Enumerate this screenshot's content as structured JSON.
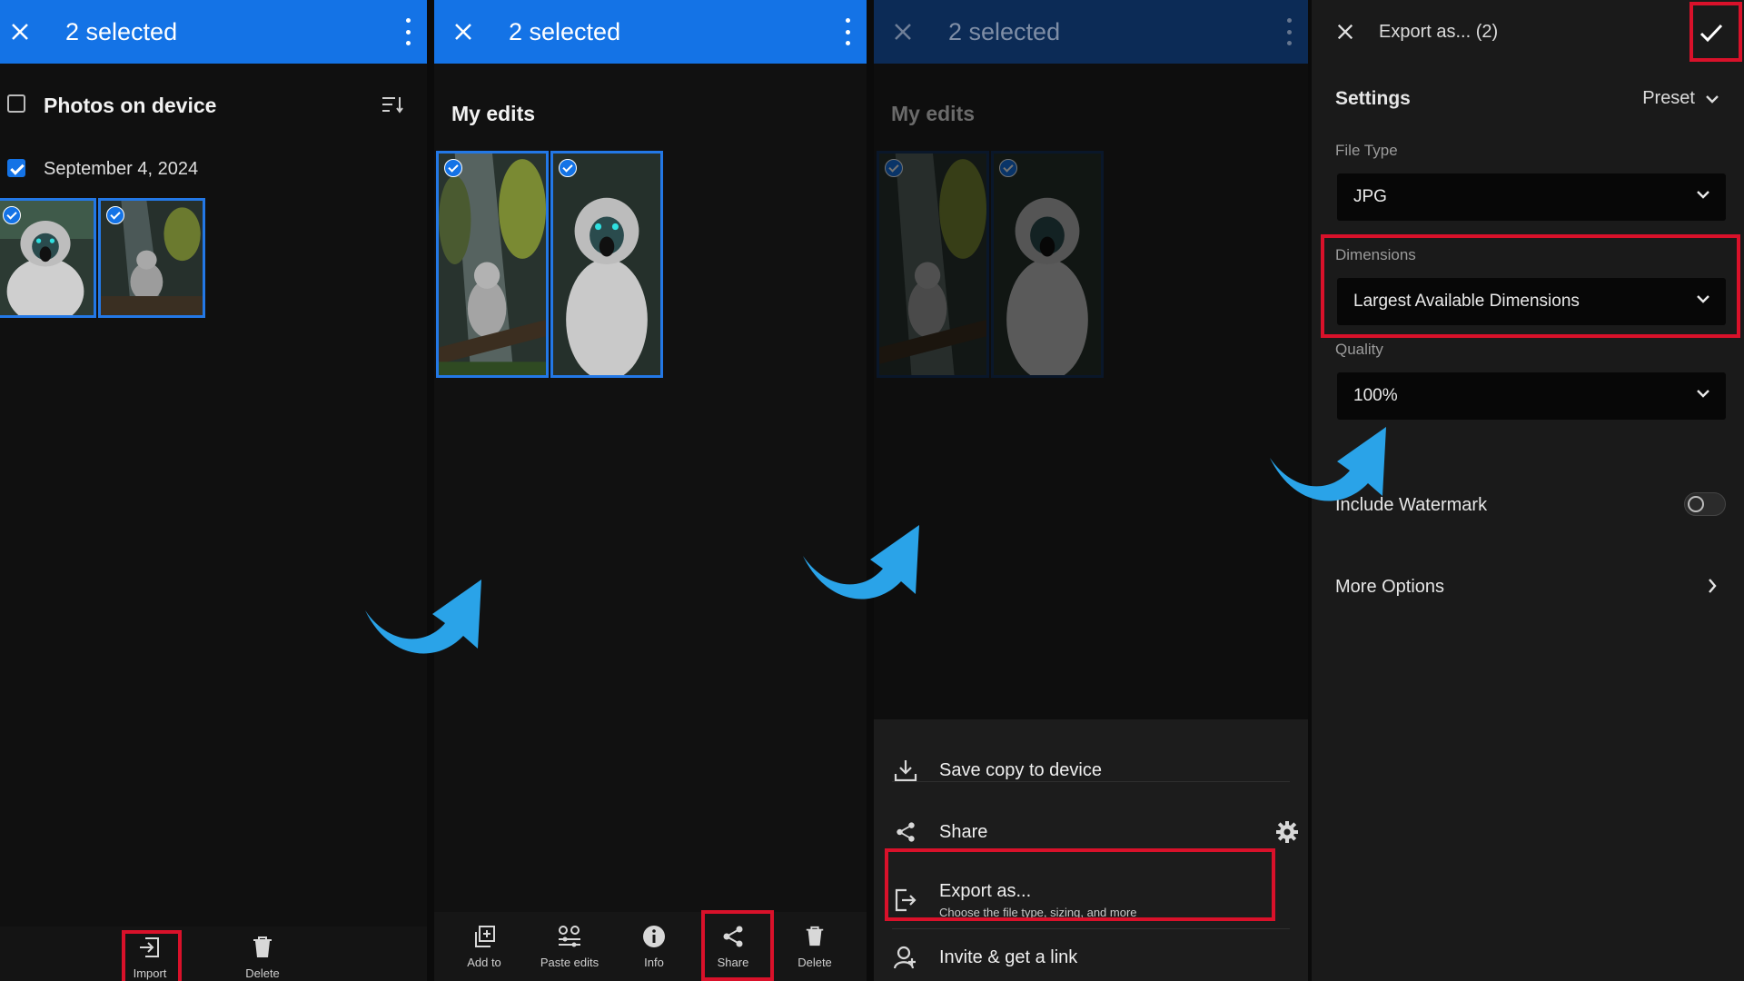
{
  "panel1": {
    "title": "2 selected",
    "section": "Photos on device",
    "date": "September 4, 2024",
    "tools": [
      {
        "label": "Import",
        "icon": "import-icon"
      },
      {
        "label": "Delete",
        "icon": "trash-icon"
      }
    ]
  },
  "panel2": {
    "title": "2 selected",
    "section": "My edits",
    "tools": [
      {
        "label": "Add to",
        "icon": "add-to-icon"
      },
      {
        "label": "Paste edits",
        "icon": "paste-edits-icon"
      },
      {
        "label": "Info",
        "icon": "info-icon"
      },
      {
        "label": "Share",
        "icon": "share-icon"
      },
      {
        "label": "Delete",
        "icon": "trash-icon"
      }
    ]
  },
  "panel3": {
    "title": "2 selected",
    "section": "My edits",
    "sheet": {
      "save_copy": "Save copy to device",
      "share": "Share",
      "export_title": "Export as...",
      "export_sub": "Choose the file type, sizing, and more",
      "invite": "Invite & get a link"
    }
  },
  "panel4": {
    "title": "Export as... (2)",
    "settings": "Settings",
    "preset": "Preset",
    "file_type_label": "File Type",
    "file_type": "JPG",
    "dimensions_label": "Dimensions",
    "dimensions": "Largest Available Dimensions",
    "quality_label": "Quality",
    "quality": "100%",
    "watermark": "Include Watermark",
    "more_options": "More Options"
  },
  "colors": {
    "accent": "#1473e6",
    "highlight": "#d9112a",
    "arrow": "#2aa3e8"
  }
}
